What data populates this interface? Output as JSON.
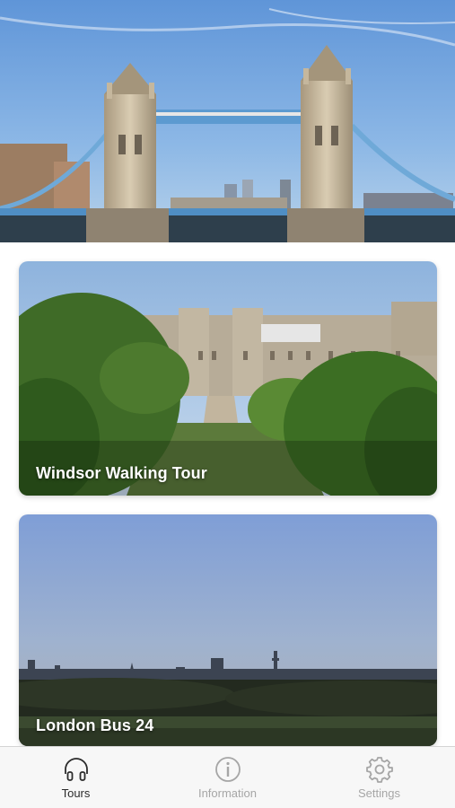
{
  "hero": {
    "image": "tower-bridge-photo"
  },
  "tours": [
    {
      "title": "Windsor Walking Tour",
      "image": "windsor-castle-photo"
    },
    {
      "title": "London Bus 24",
      "image": "london-skyline-photo"
    }
  ],
  "tabbar": {
    "tabs": [
      {
        "label": "Tours",
        "icon": "headphones-icon",
        "active": true
      },
      {
        "label": "Information",
        "icon": "info-icon",
        "active": false
      },
      {
        "label": "Settings",
        "icon": "gear-icon",
        "active": false
      }
    ]
  },
  "colors": {
    "tab_active": "#2b2b2b",
    "tab_inactive": "#a6a6a6",
    "tabbar_bg": "#f7f7f7"
  }
}
